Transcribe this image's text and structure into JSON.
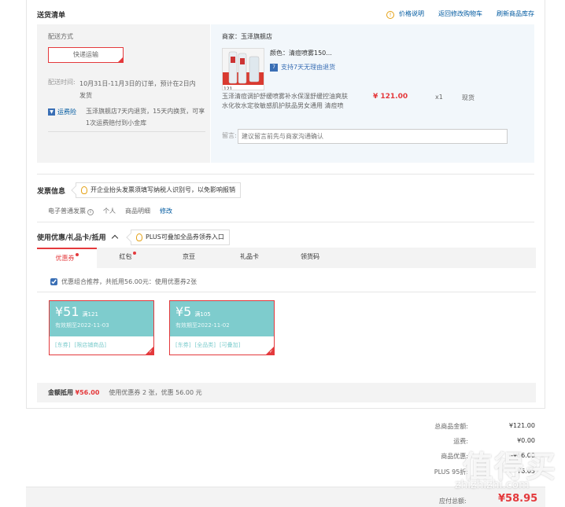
{
  "delivery": {
    "title": "送货清单",
    "links": {
      "price_info": "价格说明",
      "back_to_cart": "返回修改购物车",
      "refresh_stock": "刷新商品库存"
    },
    "method_label": "配送方式",
    "method_value": "快递运输",
    "time_label": "配送时间:",
    "time_value": "10月31日-11月3日的订单，预计在2日内发货",
    "return_badge": "运费险",
    "return_text": "玉泽旗舰店7天内退货，15天内换货，可享1次运费赔付到小金库"
  },
  "product": {
    "seller": "商家：玉泽旗舰店",
    "color_label": "颜色：",
    "color_value": "清痘喷雾150...",
    "return7": "支持7天无理由退货",
    "name": "玉泽清痘调护舒缓喷雾补水保湿舒缓控油爽肤水化妆水定妆敏感肌护肤品男女通用 清痘喷",
    "price": "¥ 121.00",
    "qty": "x1",
    "stock": "现货",
    "remark_label": "留言:",
    "remark_placeholder": "建议留言前先与商家沟通确认"
  },
  "invoice": {
    "title": "发票信息",
    "tip": "开企业抬头发票须填写纳税人识别号，以免影响报销",
    "type": "电子普通发票",
    "person": "个人",
    "detail": "商品明细",
    "edit": "修改"
  },
  "coupons": {
    "title": "使用优惠/礼品卡/抵用",
    "tip": "PLUS可叠加全品券领券入口",
    "tabs": [
      {
        "label": "优惠券",
        "dot": true
      },
      {
        "label": "红包",
        "dot": true
      },
      {
        "label": "京豆",
        "dot": false
      },
      {
        "label": "礼品卡",
        "dot": false
      },
      {
        "label": "领货码",
        "dot": false
      }
    ],
    "recommend": "优惠组合推荐，共抵用56.00元：使用优惠券2张",
    "items": [
      {
        "amount": "¥51",
        "condition": "满121",
        "expiry": "有效期至2022-11-03",
        "tags": [
          "[东券]",
          "[限店铺商品]"
        ]
      },
      {
        "amount": "¥5",
        "condition": "满105",
        "expiry": "有效期至2022-11-02",
        "tags": [
          "[东券]",
          "[全品类]",
          "[可叠加]"
        ]
      }
    ],
    "summary_label": "金额抵用",
    "summary_amount": "¥56.00",
    "summary_text": "使用优惠券 2 张，优惠 56.00 元"
  },
  "totals": [
    {
      "label": "总商品金额:",
      "value": "¥121.00"
    },
    {
      "label": "运费:",
      "value": "¥0.00"
    },
    {
      "label": "商品优惠:",
      "value": "-¥56.00"
    },
    {
      "label": "PLUS 95折:",
      "value": "-¥6.05"
    }
  ],
  "pay": {
    "label": "应付总额:",
    "amount": "¥58.95"
  },
  "watermark": {
    "big": "值得买",
    "small": "zhizhizhi.com"
  },
  "colors": {
    "accent": "#e4393c",
    "link": "#005aa0",
    "coupon": "#7ecccd"
  }
}
